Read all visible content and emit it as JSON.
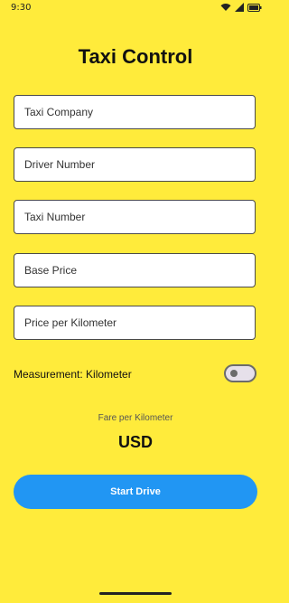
{
  "status_bar": {
    "time": "9:30",
    "icons": [
      "wifi-icon",
      "signal-icon",
      "battery-icon"
    ]
  },
  "app": {
    "title": "Taxi Control"
  },
  "form": {
    "taxi_company": {
      "placeholder": "Taxi Company",
      "value": ""
    },
    "driver_number": {
      "placeholder": "Driver Number",
      "value": ""
    },
    "taxi_number": {
      "placeholder": "Taxi Number",
      "value": ""
    },
    "base_price": {
      "placeholder": "Base Price",
      "value": ""
    },
    "price_per_km": {
      "placeholder": "Price per Kilometer",
      "value": ""
    }
  },
  "measurement": {
    "label": "Measurement: Kilometer",
    "toggle_on": false
  },
  "fare": {
    "label": "Fare per Kilometer",
    "value": "USD"
  },
  "actions": {
    "start_label": "Start Drive"
  },
  "colors": {
    "background": "#ffeb3b",
    "primary_button": "#2196f3",
    "field_background": "#ffffff"
  }
}
